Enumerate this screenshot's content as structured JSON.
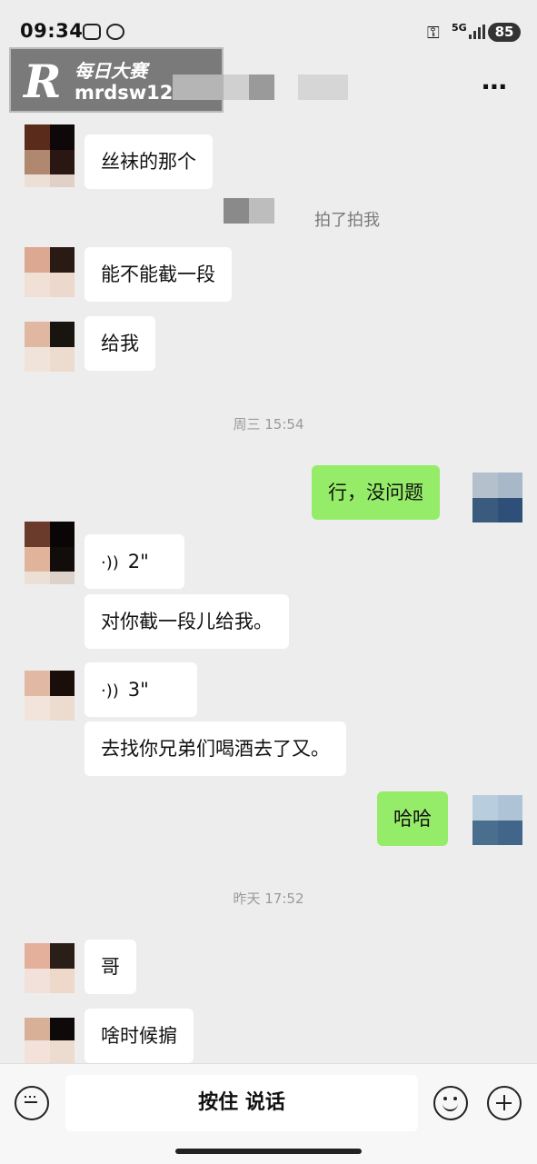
{
  "status_bar": {
    "time": "09:34",
    "signal": "5G",
    "battery": "85"
  },
  "watermark": {
    "letter": "R",
    "brand": "每日大赛",
    "url": "mrdsw12.com"
  },
  "header": {
    "more_icon": "⋯"
  },
  "messages": {
    "m1": "丝袜的那个",
    "pat": "拍了拍我",
    "m2": "能不能截一段",
    "m3": "给我",
    "time1": "周三 15:54",
    "m4": "行，没问题",
    "voice1": "2\"",
    "m5": "对你截一段儿给我。",
    "voice2": "3\"",
    "m6": "去找你兄弟们喝酒去了又。",
    "m7": "哈哈",
    "time2": "昨天 17:52",
    "m8": "哥",
    "m9": "啥时候掮"
  },
  "input_bar": {
    "talk_label": "按住 说话",
    "keyboard_icon": "keyboard-icon",
    "emoji_icon": "emoji-icon",
    "plus_icon": "plus-icon"
  }
}
